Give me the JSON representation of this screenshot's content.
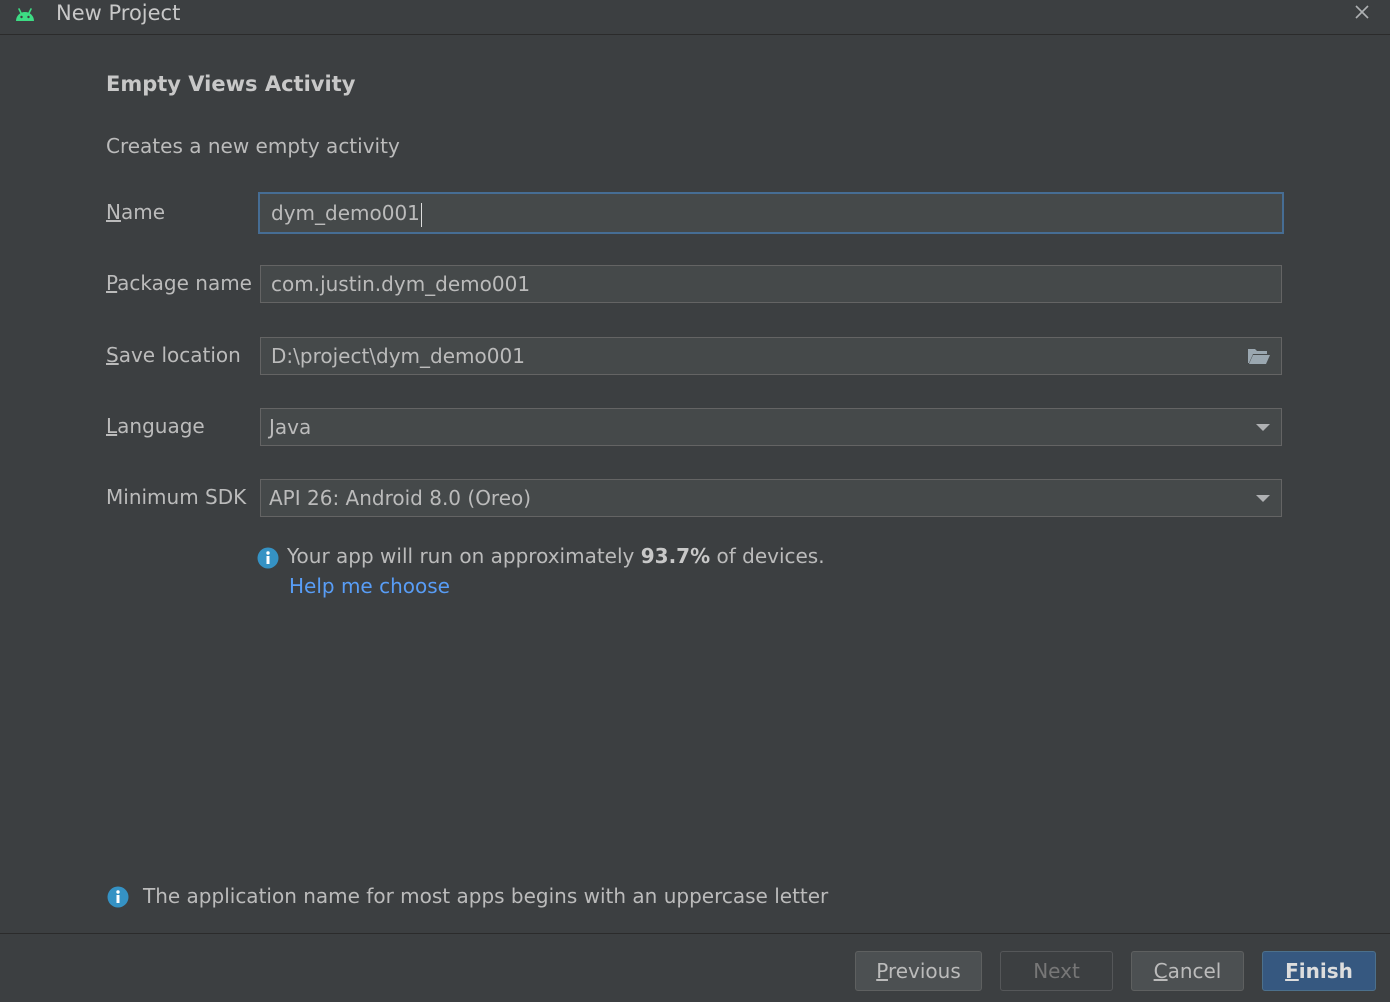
{
  "window": {
    "title": "New Project",
    "icon": "android-icon",
    "close_icon": "close-icon"
  },
  "page": {
    "heading": "Empty Views Activity",
    "subheading": "Creates a new empty activity"
  },
  "form": {
    "name": {
      "label_mnemonic": "N",
      "label_rest": "ame",
      "value": "dym_demo001"
    },
    "package": {
      "label_mnemonic": "P",
      "label_rest": "ackage name",
      "value": "com.justin.dym_demo001"
    },
    "location": {
      "label_mnemonic": "S",
      "label_rest": "ave location",
      "value": "D:\\project\\dym_demo001",
      "browse_icon": "folder-icon"
    },
    "language": {
      "label_mnemonic": "L",
      "label_rest": "anguage",
      "value": "Java"
    },
    "min_sdk": {
      "label": "Minimum SDK",
      "value": "API 26: Android 8.0 (Oreo)"
    }
  },
  "sdk_info": {
    "prefix": "Your app will run on approximately ",
    "percent": "93.7%",
    "suffix": " of devices.",
    "help_link": "Help me choose"
  },
  "hint": {
    "text": "The application name for most apps begins with an uppercase letter"
  },
  "buttons": {
    "previous": {
      "mnemonic": "P",
      "rest": "revious"
    },
    "next": {
      "label": "Next"
    },
    "cancel": {
      "mnemonic": "C",
      "rest": "ancel"
    },
    "finish": {
      "mnemonic": "F",
      "rest": "inish"
    }
  },
  "colors": {
    "background": "#3c3f41",
    "field_background": "#45494a",
    "focus_border": "#466d94",
    "link": "#589df6",
    "info_icon": "#3592c4",
    "android_green": "#3ddc84",
    "primary_button": "#365880"
  }
}
